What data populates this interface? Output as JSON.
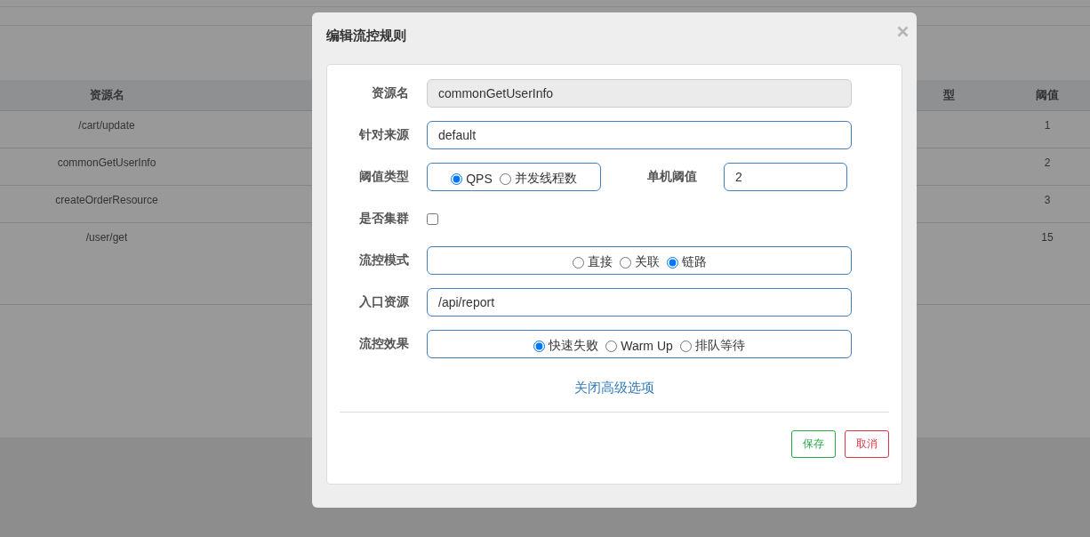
{
  "background_table": {
    "columns": [
      "资源名",
      "型",
      "阈值"
    ],
    "rows": [
      {
        "resource": "/cart/update",
        "threshold": "1"
      },
      {
        "resource": "commonGetUserInfo",
        "threshold": "2"
      },
      {
        "resource": "createOrderResource",
        "threshold": "3"
      },
      {
        "resource": "/user/get",
        "threshold": "15"
      }
    ]
  },
  "dialog": {
    "title": "编辑流控规则",
    "rows": [
      {
        "label": "资源名",
        "kind": "input",
        "value": "commonGetUserInfo",
        "disabled": true
      },
      {
        "label": "针对来源",
        "kind": "input",
        "value": "default",
        "disabled": false
      },
      {
        "label": "阈值类型",
        "kind": "radio",
        "options": [
          {
            "label": "QPS",
            "selected": true
          },
          {
            "label": "并发线程数",
            "selected": false
          }
        ],
        "extra": {
          "label": "单机阈值",
          "value": "2"
        }
      },
      {
        "label": "是否集群",
        "kind": "checkbox",
        "checked": false
      },
      {
        "label": "流控模式",
        "kind": "radio",
        "options": [
          {
            "label": "直接",
            "selected": false
          },
          {
            "label": "关联",
            "selected": false
          },
          {
            "label": "链路",
            "selected": true
          }
        ]
      },
      {
        "label": "入口资源",
        "kind": "input",
        "value": "/api/report",
        "disabled": false
      },
      {
        "label": "流控效果",
        "kind": "radio",
        "options": [
          {
            "label": "快速失败",
            "selected": true
          },
          {
            "label": "Warm Up",
            "selected": false
          },
          {
            "label": "排队等待",
            "selected": false
          }
        ]
      }
    ],
    "advanced_link": "关闭高级选项",
    "buttons": [
      {
        "label": "保存",
        "kind": "save"
      },
      {
        "label": "取消",
        "kind": "cancel"
      }
    ]
  }
}
